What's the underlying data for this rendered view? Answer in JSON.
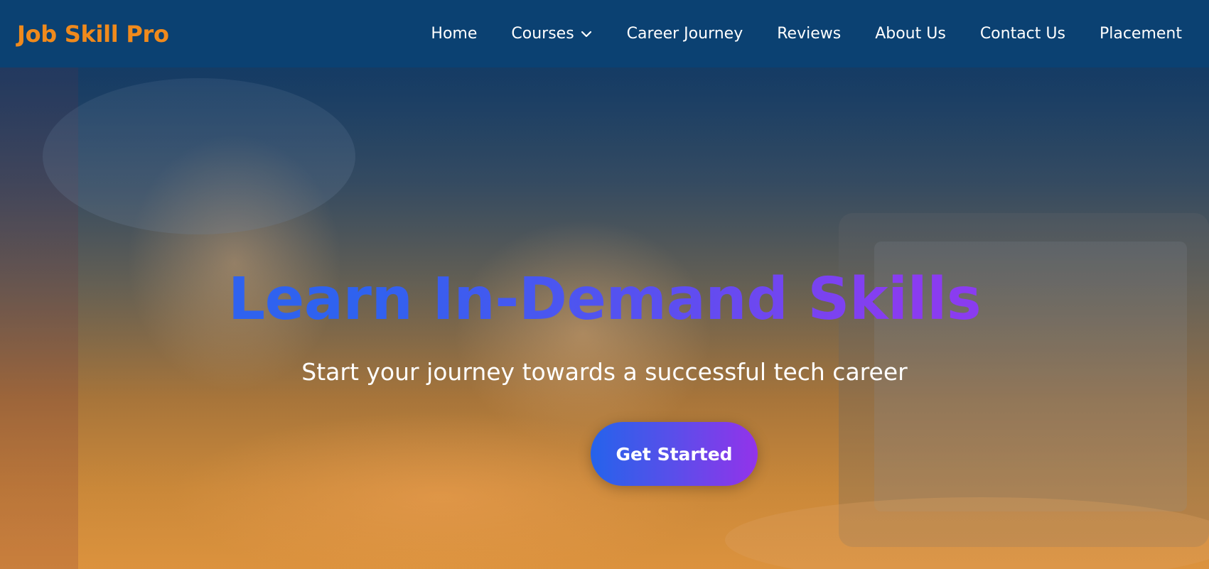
{
  "navbar": {
    "brand": "Job Skill Pro",
    "links": [
      {
        "label": "Home"
      },
      {
        "label": "Courses",
        "dropdown": true,
        "icon": "chevron-down-icon"
      },
      {
        "label": "Career Journey"
      },
      {
        "label": "Reviews"
      },
      {
        "label": "About Us"
      },
      {
        "label": "Contact Us"
      },
      {
        "label": "Placement"
      }
    ]
  },
  "hero": {
    "title": "Learn In-Demand Skills",
    "subtitle": "Start your journey towards a successful tech career",
    "cta_label": "Get Started"
  },
  "colors": {
    "navbar_bg": "#0b4172",
    "brand": "#f08a1c",
    "title_gradient_start": "#2f62ef",
    "title_gradient_end": "#8a3cf0",
    "cta_gradient_start": "#2563eb",
    "cta_gradient_end": "#9333ea"
  }
}
